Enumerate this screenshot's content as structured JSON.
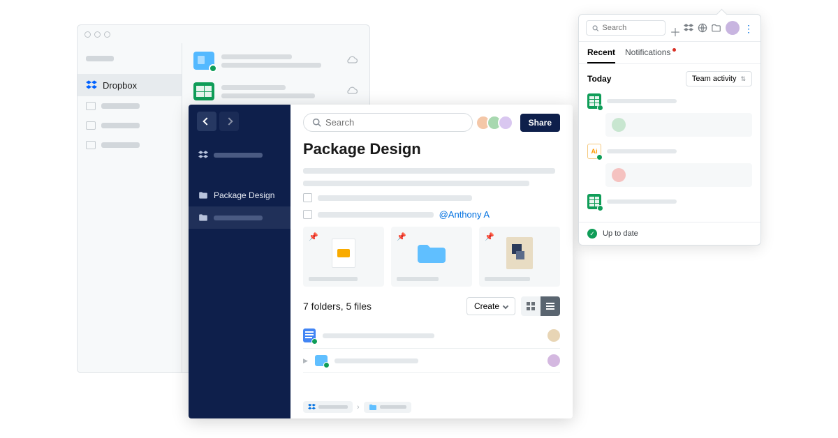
{
  "bg_window": {
    "dropbox_label": "Dropbox"
  },
  "paper": {
    "search_placeholder": "Search",
    "share_label": "Share",
    "doc_title": "Package Design",
    "mention": "@Anthony A",
    "count_text": "7 folders, 5 files",
    "create_label": "Create",
    "sidebar": {
      "folder_label": "Package Design"
    },
    "avatars": [
      {
        "bg": "#f4c7a8"
      },
      {
        "bg": "#a8d8b0"
      },
      {
        "bg": "#d9c7f0"
      }
    ],
    "row_avatars": [
      {
        "bg": "#e8d5b5"
      },
      {
        "bg": "#d4b8e0"
      }
    ]
  },
  "tray": {
    "search_placeholder": "Search",
    "tabs": {
      "recent": "Recent",
      "notifications": "Notifications"
    },
    "today_label": "Today",
    "filter_label": "Team activity",
    "status_text": "Up to date",
    "user_avatar_bg": "#c8b5e0",
    "items": [
      {
        "type": "sheet",
        "comment_avatar_bg": "#c8e6d0"
      },
      {
        "type": "ai",
        "comment_avatar_bg": "#f5c2c0"
      },
      {
        "type": "sheet"
      }
    ]
  }
}
